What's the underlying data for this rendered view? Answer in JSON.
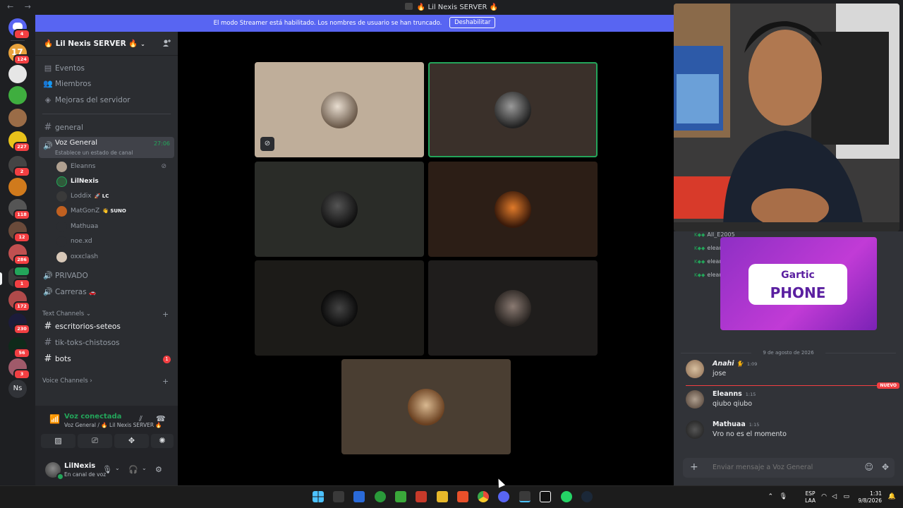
{
  "titlebar": {
    "title": "🔥 Lil Nexis SERVER 🔥",
    "nav": "← →"
  },
  "banner": {
    "text": "El modo Streamer está habilitado. Los nombres de usuario se han truncado.",
    "button": "Deshabilitar"
  },
  "rail": {
    "badges": [
      "4",
      "124",
      "227",
      "2",
      "118",
      "12",
      "286",
      "1",
      "172",
      "230",
      "56",
      "3"
    ],
    "ns_label": "Ns",
    "top_badge_1": "17"
  },
  "server": {
    "name": "🔥 Lil Nexis SERVER 🔥"
  },
  "nav": {
    "events": "Eventos",
    "members": "Miembros",
    "boosts": "Mejoras del servidor",
    "general": "general",
    "voice_general": "Voz General",
    "voice_status": "Establece un estado de canal",
    "voice_timer": "27:06",
    "privado": "PRIVADO",
    "carreras": "Carreras",
    "text_cat": "Text Channels",
    "ch1": "escritorios-seteos",
    "ch2": "tik-toks-chistosos",
    "ch3": "bots",
    "ch3_badge": "1",
    "voice_cat": "Voice Channels"
  },
  "voice_users": [
    {
      "name": "Eleanns",
      "tag": ""
    },
    {
      "name": "LilNexis",
      "tag": ""
    },
    {
      "name": "Loddix",
      "tag": "LC"
    },
    {
      "name": "MatGonZ",
      "tag": "SUNO"
    },
    {
      "name": "Mathuaa",
      "tag": ""
    },
    {
      "name": "noe.xd",
      "tag": ""
    },
    {
      "name": "oxxclash",
      "tag": ""
    }
  ],
  "voice_panel": {
    "status": "Voz conectada",
    "where": "Voz General / 🔥 Lil Nexis SERVER 🔥"
  },
  "user_panel": {
    "name": "LilNexis",
    "status": "En canal de voz"
  },
  "chat": {
    "mini_names": [
      "All_E2005",
      "eleanns",
      "eleanns",
      "eleanns"
    ],
    "gartic_top": "Gartic",
    "gartic_bottom": "PHONE",
    "date": "9 de agosto de 2026",
    "new_tag": "NUEVO",
    "messages": [
      {
        "author": "Anahi",
        "time": "1:09",
        "text": "jose"
      },
      {
        "author": "Eleanns",
        "time": "1:15",
        "text": "qiubo qiubo"
      },
      {
        "author": "Mathuaa",
        "time": "1:15",
        "text": "Vro no es el momento"
      }
    ],
    "input_placeholder": "Enviar mensaje a Voz General"
  },
  "tray": {
    "lang1": "ESP",
    "lang2": "LAA",
    "time": "1:31",
    "date": "9/8/2026"
  },
  "colors": {
    "accent": "#5865f2",
    "online": "#23a55a",
    "danger": "#f23f42"
  }
}
